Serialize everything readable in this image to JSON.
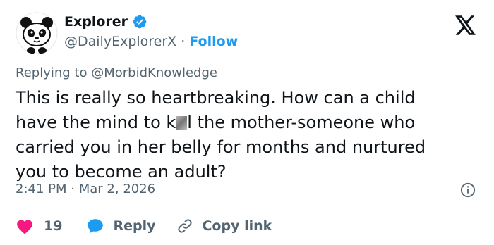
{
  "author": {
    "name": "Explorer",
    "handle": "@DailyExplorerX",
    "separator": "·",
    "follow_label": "Follow",
    "verified_color": "#1d9bf0",
    "avatar_icon": "panda-avatar"
  },
  "reply_context": {
    "prefix": "Replying to",
    "mention": "@MorbidKnowledge"
  },
  "tweet": {
    "text_before_censor": "This is really so heartbreaking. How can a child\nhave the mind to k",
    "text_after_censor": "l the mother-someone who\ncarried you in her belly for months and nurtured\nyou to become an adult?"
  },
  "meta": {
    "time": "2:41 PM",
    "separator": "·",
    "date": "Mar 2, 2026"
  },
  "actions": {
    "like_count": "19",
    "reply_label": "Reply",
    "copy_label": "Copy link"
  },
  "colors": {
    "like": "#f91880",
    "reply": "#1d9bf0",
    "link": "#1d9bf0",
    "secondary_text": "#536471"
  }
}
